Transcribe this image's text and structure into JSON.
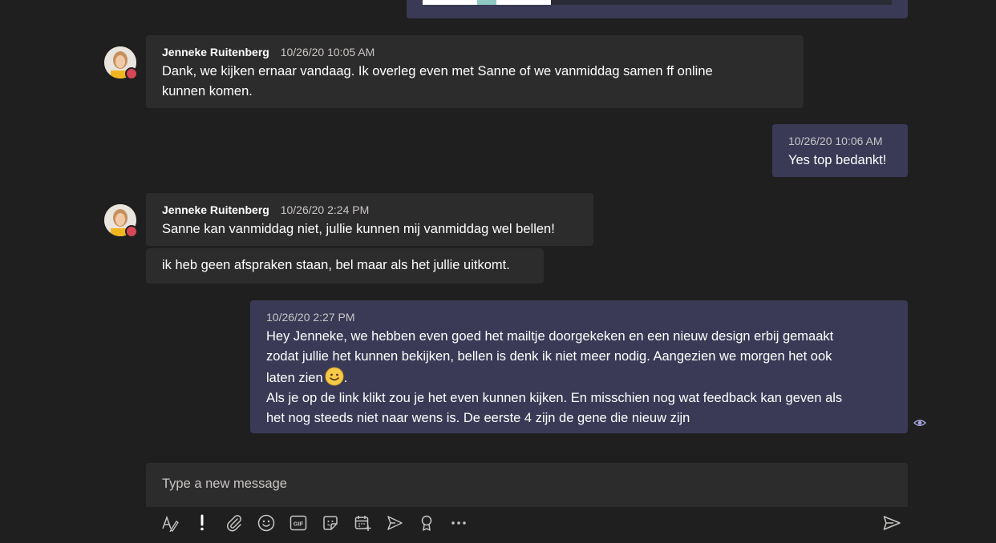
{
  "messages": [
    {
      "direction": "in",
      "author": "Jenneke Ruitenberg",
      "timestamp": "10/26/20 10:05 AM",
      "lines": [
        "Dank, we kijken ernaar vandaag. Ik overleg even met Sanne of we vanmiddag samen ff online",
        "kunnen komen."
      ]
    },
    {
      "direction": "out",
      "timestamp": "10/26/20 10:06 AM",
      "lines": [
        "Yes top bedankt!"
      ]
    },
    {
      "direction": "in",
      "author": "Jenneke Ruitenberg",
      "timestamp": "10/26/20 2:24 PM",
      "lines": [
        "Sanne kan vanmiddag niet, jullie kunnen mij vanmiddag wel bellen!"
      ]
    },
    {
      "direction": "in",
      "lines": [
        "ik heb geen afspraken staan, bel maar als het jullie uitkomt."
      ]
    },
    {
      "direction": "out",
      "timestamp": "10/26/20 2:27 PM",
      "lines": [
        "Hey Jenneke, we hebben even goed het mailtje doorgekeken en een nieuw design erbij gemaakt",
        "zodat jullie het kunnen bekijken, bellen is denk ik niet meer nodig. Aangezien we morgen het ook",
        "laten zien",
        "Als je op de link klikt zou je het even kunnen kijken. En misschien nog wat feedback kan geven als",
        "het nog steeds niet naar wens is. De eerste 4 zijn de gene die nieuw zijn"
      ],
      "inline_emoji": "smile-emoji",
      "after_emoji": "."
    }
  ],
  "compose": {
    "placeholder": "Type a new message"
  },
  "toolbar": {
    "icons": [
      "format-icon",
      "important-icon",
      "attach-icon",
      "emoji-icon",
      "gif-icon",
      "sticker-icon",
      "schedule-meeting-icon",
      "stream-icon",
      "praise-icon",
      "more-icon"
    ]
  },
  "colors": {
    "background": "#1f1f1f",
    "incoming_bubble": "#2d2c2c",
    "outgoing_bubble": "#3a3a57",
    "presence_busy": "#d74654"
  }
}
